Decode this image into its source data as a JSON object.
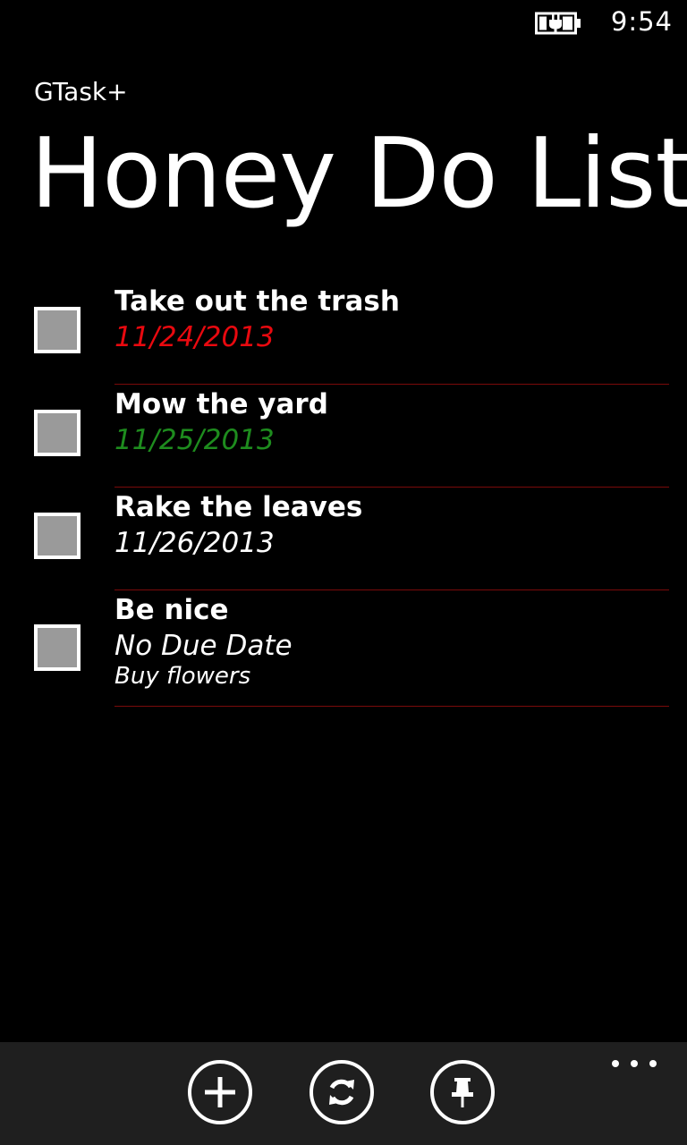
{
  "status_bar": {
    "time": "9:54",
    "battery_icon": "battery-charging-icon"
  },
  "app": {
    "title": "GTask+"
  },
  "page": {
    "title": "Honey Do List"
  },
  "colors": {
    "overdue": "#e8090f",
    "due_soon": "#1e8c1e",
    "normal": "#ffffff",
    "divider": "#7a0a0a",
    "app_bar": "#1f1f1f",
    "checkbox_fill": "#9a9a9a"
  },
  "tasks": [
    {
      "title": "Take out the trash",
      "due": "11/24/2013",
      "due_color": "#e8090f",
      "checked": false
    },
    {
      "title": "Mow the yard",
      "due": "11/25/2013",
      "due_color": "#1e8c1e",
      "checked": false
    },
    {
      "title": "Rake the leaves",
      "due": "11/26/2013",
      "due_color": "#ffffff",
      "checked": false
    },
    {
      "title": "Be nice",
      "due": "No Due Date",
      "due_color": "#ffffff",
      "note": "Buy flowers",
      "checked": false
    }
  ],
  "app_bar": {
    "buttons": [
      {
        "icon": "add-icon"
      },
      {
        "icon": "sync-icon"
      },
      {
        "icon": "pin-icon"
      }
    ],
    "more_icon": "more-icon"
  }
}
